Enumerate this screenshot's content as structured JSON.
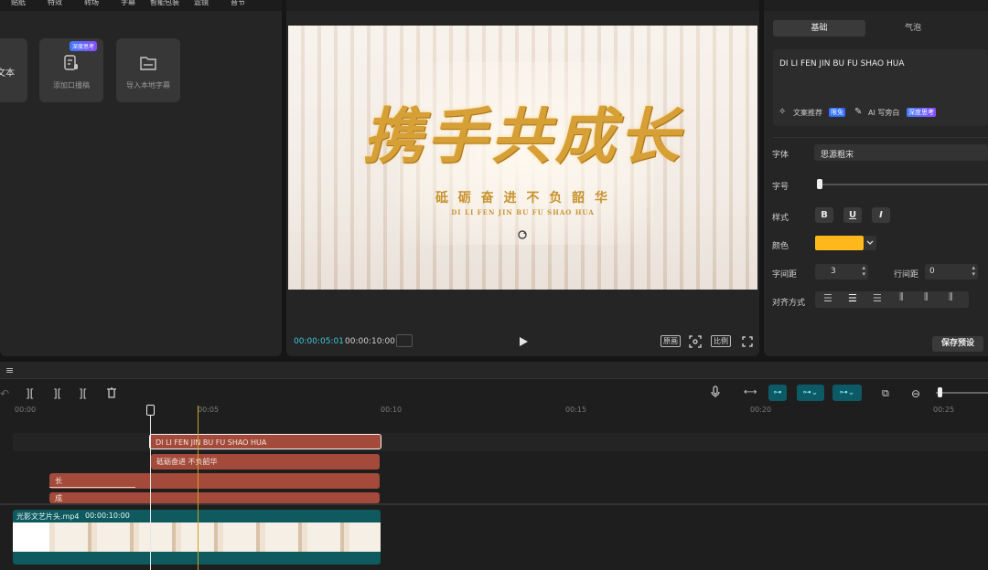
{
  "top_tabs": [
    "贴纸",
    "特效",
    "转场",
    "字幕",
    "智能包装",
    "滤镜",
    "音节"
  ],
  "left_panel": {
    "cards": [
      {
        "label": "文本",
        "icon": "text-icon"
      },
      {
        "label": "添加口播稿",
        "icon": "script-icon",
        "badge": "深度思考"
      },
      {
        "label": "导入本地字幕",
        "icon": "folder-icon"
      }
    ]
  },
  "preview": {
    "title_main": "携手共成长",
    "title_sub": "砥 砺 奋 进   不 负 韶 华",
    "title_pinyin": "DI LI FEN JIN  BU FU SHAO HUA"
  },
  "player": {
    "current_time": "00:00:05:01",
    "total_time": "00:00:10:00",
    "original_label": "原画",
    "ratio_label": "比例"
  },
  "right_panel": {
    "tabs": [
      "基础",
      "气泡"
    ],
    "active_tab": "基础",
    "text_content": "DI LI FEN JIN  BU FU SHAO HUA",
    "recommend_label": "文案推荐",
    "recommend_badge": "限免",
    "ai_label": "AI 写旁白",
    "ai_badge": "深度思考",
    "font_label": "字体",
    "font_value": "思源粗宋",
    "size_label": "字号",
    "style_label": "样式",
    "style_buttons": [
      "B",
      "U",
      "I"
    ],
    "color_label": "颜色",
    "color_value": "#FFB81C",
    "letter_spacing_label": "字间距",
    "letter_spacing_value": "3",
    "line_spacing_label": "行间距",
    "line_spacing_value": "0",
    "align_label": "对齐方式",
    "save_preset": "保存预设"
  },
  "timeline": {
    "ruler_ticks": [
      "00:00",
      "00:05",
      "00:10",
      "00:15",
      "00:20",
      "00:25"
    ],
    "text_clips": [
      "DI LI FEN JIN  BU FU SHAO HUA",
      "砥砺奋进 不负韶华",
      "长",
      "成"
    ],
    "video_clip_name": "光影文艺片头.mp4",
    "video_clip_duration": "00:00:10:00"
  }
}
